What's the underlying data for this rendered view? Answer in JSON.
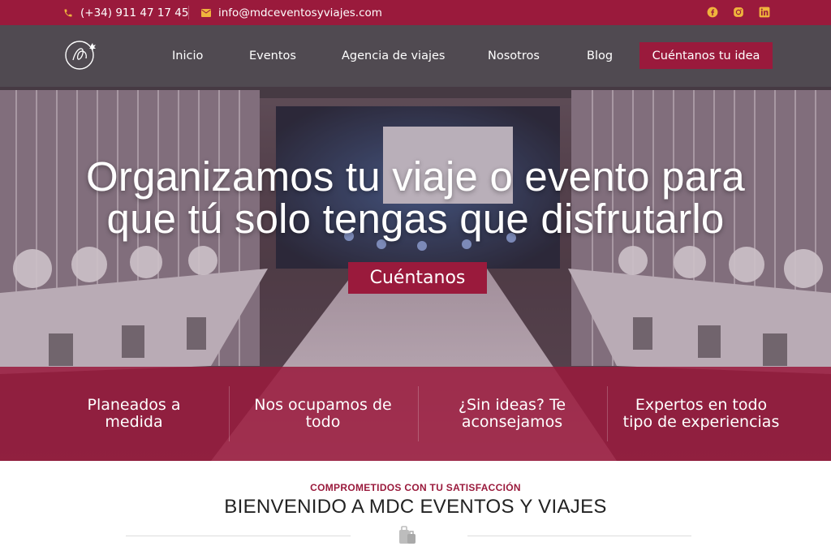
{
  "topbar": {
    "phone": "(+34) 911 47 17 45",
    "email": "info@mdceventosyviajes.com",
    "social": [
      "facebook-icon",
      "instagram-icon",
      "linkedin-icon"
    ],
    "icon_color": "#f0b43c"
  },
  "nav": {
    "items": [
      "Inicio",
      "Eventos",
      "Agencia de viajes",
      "Nosotros",
      "Blog"
    ],
    "cta": "Cuéntanos tu idea"
  },
  "hero": {
    "headline_line1": "Organizamos tu viaje o evento para",
    "headline_line2": "que tú solo tengas que disfrutarlo",
    "cta": "Cuéntanos"
  },
  "features": [
    {
      "line1": "Planeados a",
      "line2": "medida"
    },
    {
      "line1": "Nos ocupamos de",
      "line2": "todo"
    },
    {
      "line1": "¿Sin ideas? Te",
      "line2": "aconsejamos"
    },
    {
      "line1": "Expertos en todo",
      "line2": "tipo de experiencias"
    }
  ],
  "welcome": {
    "kicker": "COMPROMETIDOS CON TU SATISFACCIÓN",
    "title": "BIENVENIDO A MDC EVENTOS Y VIAJES"
  },
  "colors": {
    "brand": "#9a1a3c",
    "accent": "#f0b43c"
  }
}
